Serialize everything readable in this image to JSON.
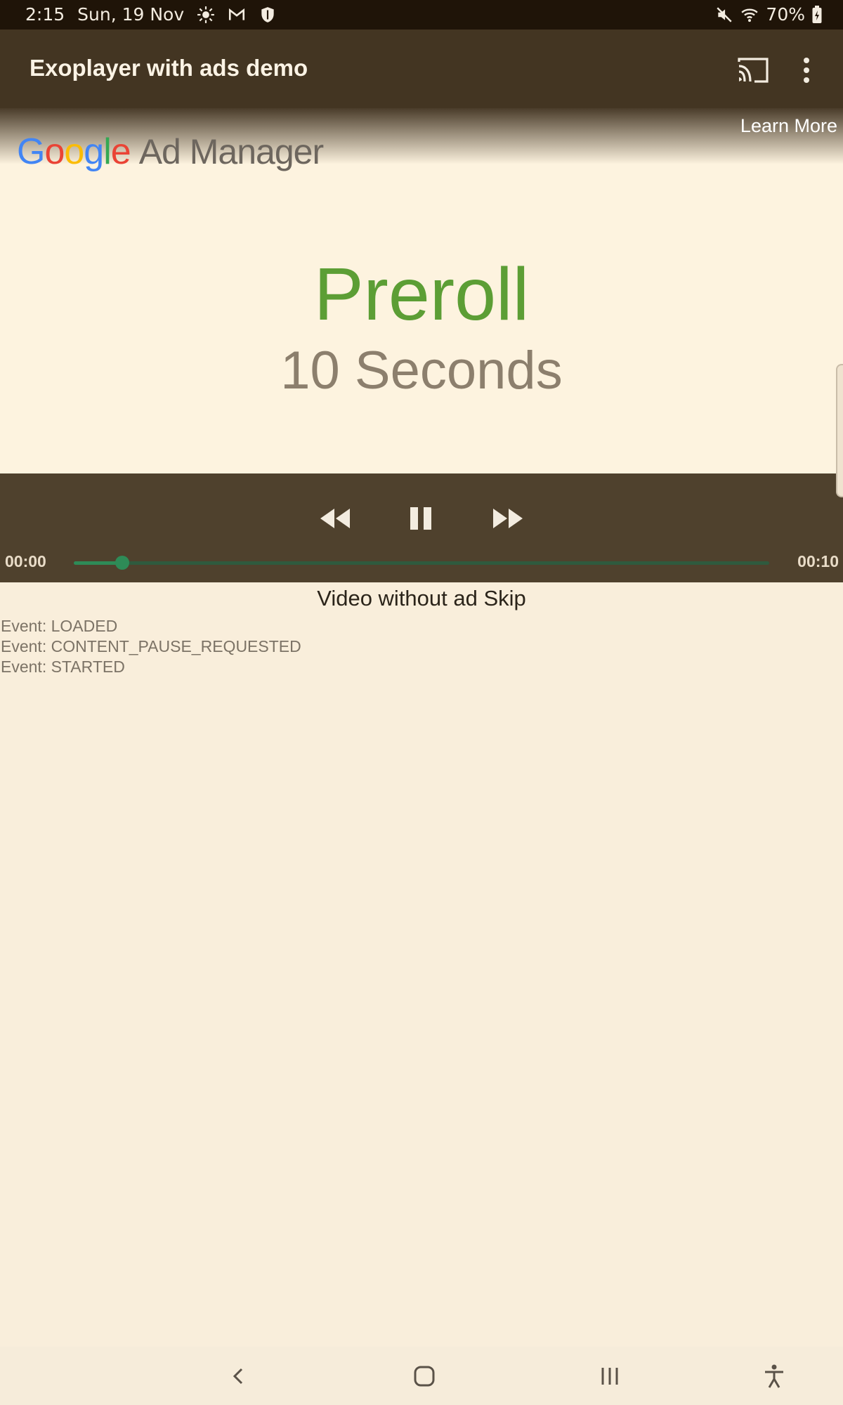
{
  "status_bar": {
    "time": "2:15",
    "date": "Sun, 19 Nov",
    "battery": "70%",
    "icons_left": [
      "brightness-icon",
      "gmail-icon",
      "shield-icon"
    ],
    "icons_right": [
      "mute-icon",
      "wifi-icon",
      "battery-icon"
    ]
  },
  "app_bar": {
    "title": "Exoplayer with ads demo",
    "actions": [
      "cast-icon",
      "more-vert-icon"
    ]
  },
  "ad": {
    "learn_more": "Learn More",
    "logo_google": "Google",
    "logo_product": "Ad Manager",
    "headline": "Preroll",
    "subheadline": "10 Seconds"
  },
  "player": {
    "position": "00:00",
    "duration": "00:10",
    "progress": 0.07,
    "controls": [
      "rewind-icon",
      "pause-icon",
      "fast-forward-icon"
    ]
  },
  "content": {
    "video_label": "Video without ad Skip",
    "events": [
      "Event: LOADED",
      "Event: CONTENT_PAUSE_REQUESTED",
      "Event: STARTED"
    ]
  },
  "colors": {
    "accent": "#2e8b57",
    "app_bar": "#433522",
    "background": "#f9eedb"
  }
}
